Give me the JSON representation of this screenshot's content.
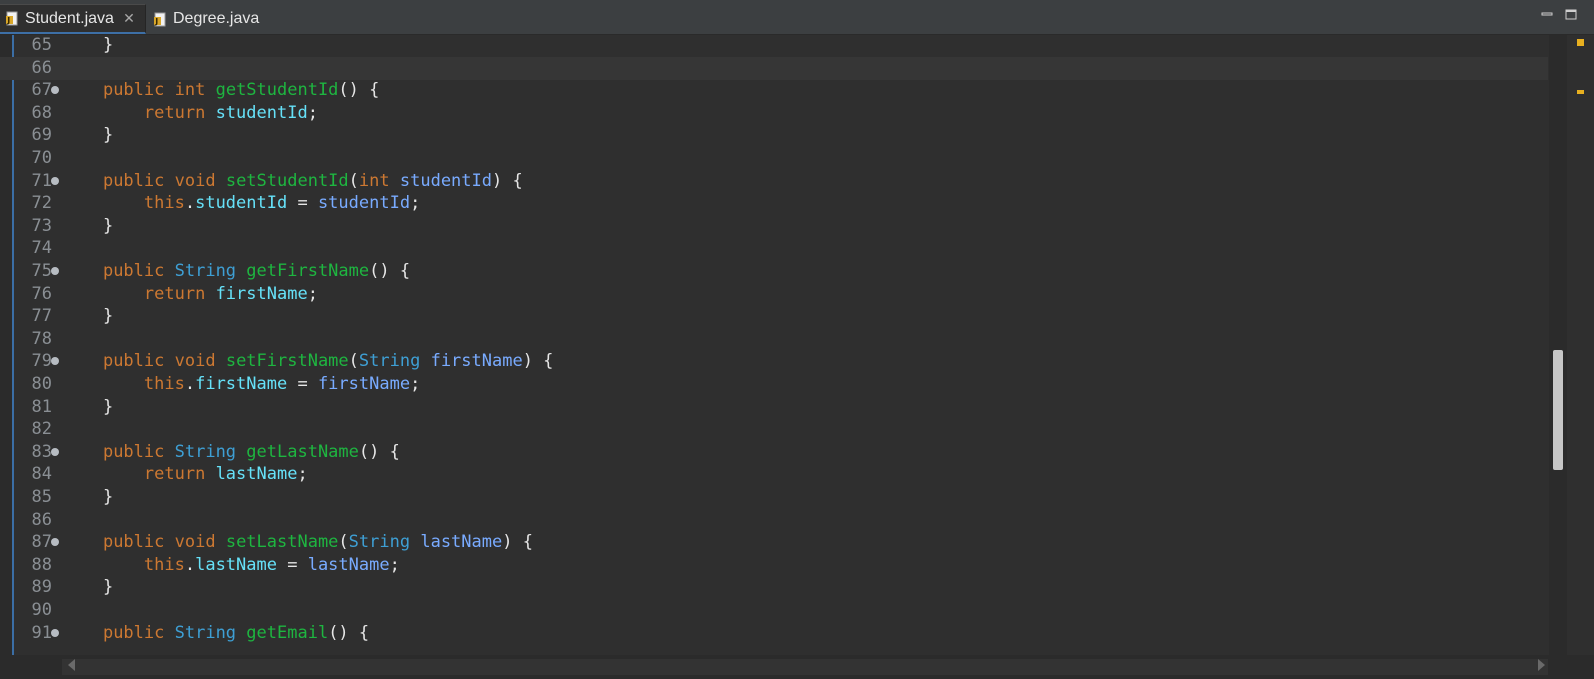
{
  "tabs": [
    {
      "label": "Student.java",
      "active": true,
      "close": "✕"
    },
    {
      "label": "Degree.java",
      "active": false
    }
  ],
  "colors": {
    "keyword": "#cc7832",
    "type": "#3e9fd4",
    "method": "#1eb540",
    "field": "#66e1f8",
    "param": "#79abff",
    "text": "#d9d9d9",
    "accent": "#3b6ea5"
  },
  "editor": {
    "current_line": 66,
    "lines": [
      {
        "n": "65",
        "fold": false,
        "tokens": [
          [
            "pu",
            "    }"
          ]
        ]
      },
      {
        "n": "66",
        "fold": false,
        "tokens": []
      },
      {
        "n": "67",
        "fold": true,
        "tokens": [
          [
            "pu",
            "    "
          ],
          [
            "kw",
            "public"
          ],
          [
            "pu",
            " "
          ],
          [
            "kw",
            "int"
          ],
          [
            "pu",
            " "
          ],
          [
            "mt",
            "getStudentId"
          ],
          [
            "pu",
            "() {"
          ]
        ]
      },
      {
        "n": "68",
        "fold": false,
        "tokens": [
          [
            "pu",
            "        "
          ],
          [
            "kw",
            "return"
          ],
          [
            "pu",
            " "
          ],
          [
            "fd",
            "studentId"
          ],
          [
            "pu",
            ";"
          ]
        ]
      },
      {
        "n": "69",
        "fold": false,
        "tokens": [
          [
            "pu",
            "    }"
          ]
        ]
      },
      {
        "n": "70",
        "fold": false,
        "tokens": []
      },
      {
        "n": "71",
        "fold": true,
        "tokens": [
          [
            "pu",
            "    "
          ],
          [
            "kw",
            "public"
          ],
          [
            "pu",
            " "
          ],
          [
            "kw",
            "void"
          ],
          [
            "pu",
            " "
          ],
          [
            "mt",
            "setStudentId"
          ],
          [
            "pu",
            "("
          ],
          [
            "kw",
            "int"
          ],
          [
            "pu",
            " "
          ],
          [
            "pm",
            "studentId"
          ],
          [
            "pu",
            ") {"
          ]
        ]
      },
      {
        "n": "72",
        "fold": false,
        "tokens": [
          [
            "pu",
            "        "
          ],
          [
            "kw",
            "this"
          ],
          [
            "pu",
            "."
          ],
          [
            "fd",
            "studentId"
          ],
          [
            "pu",
            " = "
          ],
          [
            "pm",
            "studentId"
          ],
          [
            "pu",
            ";"
          ]
        ]
      },
      {
        "n": "73",
        "fold": false,
        "tokens": [
          [
            "pu",
            "    }"
          ]
        ]
      },
      {
        "n": "74",
        "fold": false,
        "tokens": []
      },
      {
        "n": "75",
        "fold": true,
        "tokens": [
          [
            "pu",
            "    "
          ],
          [
            "kw",
            "public"
          ],
          [
            "pu",
            " "
          ],
          [
            "ty",
            "String"
          ],
          [
            "pu",
            " "
          ],
          [
            "mt",
            "getFirstName"
          ],
          [
            "pu",
            "() {"
          ]
        ]
      },
      {
        "n": "76",
        "fold": false,
        "tokens": [
          [
            "pu",
            "        "
          ],
          [
            "kw",
            "return"
          ],
          [
            "pu",
            " "
          ],
          [
            "fd",
            "firstName"
          ],
          [
            "pu",
            ";"
          ]
        ]
      },
      {
        "n": "77",
        "fold": false,
        "tokens": [
          [
            "pu",
            "    }"
          ]
        ]
      },
      {
        "n": "78",
        "fold": false,
        "tokens": []
      },
      {
        "n": "79",
        "fold": true,
        "tokens": [
          [
            "pu",
            "    "
          ],
          [
            "kw",
            "public"
          ],
          [
            "pu",
            " "
          ],
          [
            "kw",
            "void"
          ],
          [
            "pu",
            " "
          ],
          [
            "mt",
            "setFirstName"
          ],
          [
            "pu",
            "("
          ],
          [
            "ty",
            "String"
          ],
          [
            "pu",
            " "
          ],
          [
            "pm",
            "firstName"
          ],
          [
            "pu",
            ") {"
          ]
        ]
      },
      {
        "n": "80",
        "fold": false,
        "tokens": [
          [
            "pu",
            "        "
          ],
          [
            "kw",
            "this"
          ],
          [
            "pu",
            "."
          ],
          [
            "fd",
            "firstName"
          ],
          [
            "pu",
            " = "
          ],
          [
            "pm",
            "firstName"
          ],
          [
            "pu",
            ";"
          ]
        ]
      },
      {
        "n": "81",
        "fold": false,
        "tokens": [
          [
            "pu",
            "    }"
          ]
        ]
      },
      {
        "n": "82",
        "fold": false,
        "tokens": []
      },
      {
        "n": "83",
        "fold": true,
        "tokens": [
          [
            "pu",
            "    "
          ],
          [
            "kw",
            "public"
          ],
          [
            "pu",
            " "
          ],
          [
            "ty",
            "String"
          ],
          [
            "pu",
            " "
          ],
          [
            "mt",
            "getLastName"
          ],
          [
            "pu",
            "() {"
          ]
        ]
      },
      {
        "n": "84",
        "fold": false,
        "tokens": [
          [
            "pu",
            "        "
          ],
          [
            "kw",
            "return"
          ],
          [
            "pu",
            " "
          ],
          [
            "fd",
            "lastName"
          ],
          [
            "pu",
            ";"
          ]
        ]
      },
      {
        "n": "85",
        "fold": false,
        "tokens": [
          [
            "pu",
            "    }"
          ]
        ]
      },
      {
        "n": "86",
        "fold": false,
        "tokens": []
      },
      {
        "n": "87",
        "fold": true,
        "tokens": [
          [
            "pu",
            "    "
          ],
          [
            "kw",
            "public"
          ],
          [
            "pu",
            " "
          ],
          [
            "kw",
            "void"
          ],
          [
            "pu",
            " "
          ],
          [
            "mt",
            "setLastName"
          ],
          [
            "pu",
            "("
          ],
          [
            "ty",
            "String"
          ],
          [
            "pu",
            " "
          ],
          [
            "pm",
            "lastName"
          ],
          [
            "pu",
            ") {"
          ]
        ]
      },
      {
        "n": "88",
        "fold": false,
        "tokens": [
          [
            "pu",
            "        "
          ],
          [
            "kw",
            "this"
          ],
          [
            "pu",
            "."
          ],
          [
            "fd",
            "lastName"
          ],
          [
            "pu",
            " = "
          ],
          [
            "pm",
            "lastName"
          ],
          [
            "pu",
            ";"
          ]
        ]
      },
      {
        "n": "89",
        "fold": false,
        "tokens": [
          [
            "pu",
            "    }"
          ]
        ]
      },
      {
        "n": "90",
        "fold": false,
        "tokens": []
      },
      {
        "n": "91",
        "fold": true,
        "tokens": [
          [
            "pu",
            "    "
          ],
          [
            "kw",
            "public"
          ],
          [
            "pu",
            " "
          ],
          [
            "ty",
            "String"
          ],
          [
            "pu",
            " "
          ],
          [
            "mt",
            "getEmail"
          ],
          [
            "pu",
            "() {"
          ]
        ]
      }
    ]
  },
  "icons": {
    "tab_file": "java-file-icon",
    "minimize": "minimize-icon",
    "maximize": "maximize-icon",
    "fold": "fold-collapse-icon",
    "scroll_left": "scroll-left-arrow-icon",
    "scroll_right": "scroll-right-arrow-icon"
  },
  "scroll": {
    "vertical_position": 0.55
  }
}
